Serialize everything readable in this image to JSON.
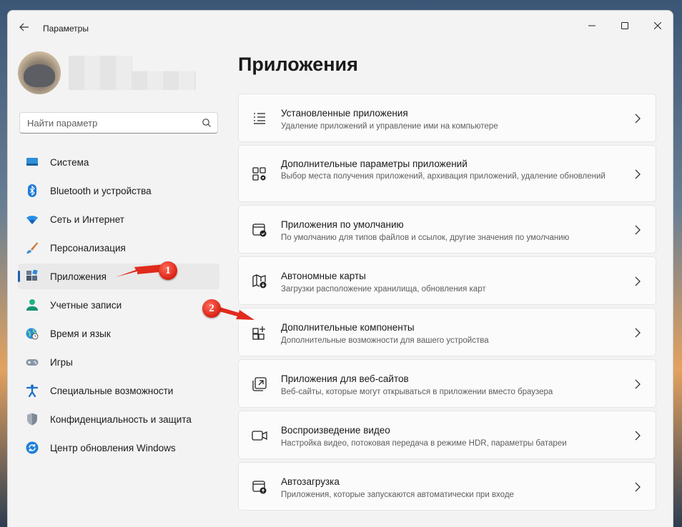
{
  "window": {
    "title": "Параметры"
  },
  "search": {
    "placeholder": "Найти параметр"
  },
  "sidebar": {
    "items": [
      {
        "label": "Система",
        "icon": "system-icon"
      },
      {
        "label": "Bluetooth и устройства",
        "icon": "bluetooth-icon"
      },
      {
        "label": "Сеть и Интернет",
        "icon": "wifi-icon"
      },
      {
        "label": "Персонализация",
        "icon": "brush-icon"
      },
      {
        "label": "Приложения",
        "icon": "apps-icon"
      },
      {
        "label": "Учетные записи",
        "icon": "account-icon"
      },
      {
        "label": "Время и язык",
        "icon": "globe-clock-icon"
      },
      {
        "label": "Игры",
        "icon": "gamepad-icon"
      },
      {
        "label": "Специальные возможности",
        "icon": "accessibility-icon"
      },
      {
        "label": "Конфиденциальность и защита",
        "icon": "shield-icon"
      },
      {
        "label": "Центр обновления Windows",
        "icon": "update-icon"
      }
    ],
    "active_index": 4
  },
  "main": {
    "title": "Приложения",
    "cards": [
      {
        "title": "Установленные приложения",
        "desc": "Удаление приложений и управление ими на компьютере",
        "icon": "list-icon"
      },
      {
        "title": "Дополнительные параметры приложений",
        "desc": "Выбор места получения приложений, архивация приложений, удаление обновлений",
        "icon": "apps-settings-icon"
      },
      {
        "title": "Приложения по умолчанию",
        "desc": "По умолчанию для типов файлов и ссылок, другие значения по умолчанию",
        "icon": "default-apps-icon"
      },
      {
        "title": "Автономные карты",
        "desc": "Загрузки расположение хранилища, обновления карт",
        "icon": "map-icon"
      },
      {
        "title": "Дополнительные компоненты",
        "desc": "Дополнительные возможности для вашего устройства",
        "icon": "add-components-icon"
      },
      {
        "title": "Приложения для веб-сайтов",
        "desc": "Веб-сайты, которые могут открываться в приложении вместо браузера",
        "icon": "open-in-app-icon"
      },
      {
        "title": "Воспроизведение видео",
        "desc": "Настройка видео, потоковая передача в режиме HDR, параметры батареи",
        "icon": "video-icon"
      },
      {
        "title": "Автозагрузка",
        "desc": "Приложения, которые запускаются автоматически при входе",
        "icon": "startup-icon"
      }
    ]
  },
  "annotations": [
    {
      "label": "1"
    },
    {
      "label": "2"
    }
  ],
  "colors": {
    "accent": "#1e5fb4",
    "annotation_red": "#e02b1c"
  }
}
